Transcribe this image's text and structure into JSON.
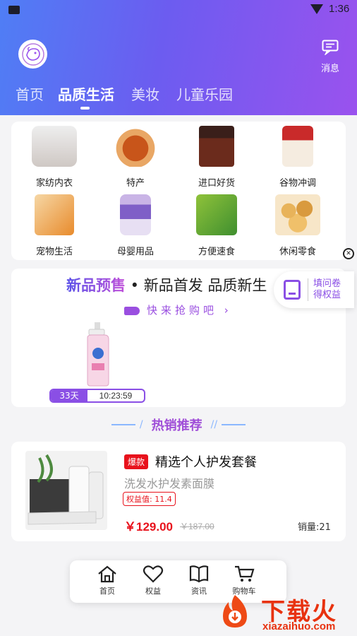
{
  "status_bar": {
    "time": "1:36"
  },
  "header": {
    "message_label": "消息",
    "tabs": [
      {
        "label": "首页",
        "active": false
      },
      {
        "label": "品质生活",
        "active": true
      },
      {
        "label": "美妆",
        "active": false
      },
      {
        "label": "儿童乐园",
        "active": false
      }
    ]
  },
  "categories": [
    {
      "label": "家纺内衣",
      "icon": "bedding-image"
    },
    {
      "label": "特产",
      "icon": "roast-chicken-image"
    },
    {
      "label": "进口好货",
      "icon": "cosmetic-jar-image"
    },
    {
      "label": "谷物冲调",
      "icon": "cereal-bag-image"
    },
    {
      "label": "宠物生活",
      "icon": "pet-treats-image"
    },
    {
      "label": "母婴用品",
      "icon": "milk-formula-image"
    },
    {
      "label": "方便速食",
      "icon": "instant-noodles-image"
    },
    {
      "label": "休闲零食",
      "icon": "popcorn-image"
    }
  ],
  "presale": {
    "title_highlight": "新品预售",
    "title_rest": " • 新品首发 品质新生",
    "subtitle": "快来抢购吧",
    "countdown_days": "33天",
    "countdown_time": "10:23:59"
  },
  "survey": {
    "line1": "填问卷",
    "line2": "得权益"
  },
  "hot_section": {
    "title": "热销推荐"
  },
  "product": {
    "badge": "爆款",
    "name": "精选个人护发套餐",
    "subtitle": "洗发水护发素面膜",
    "tag": "权益值: 11.4",
    "price": "￥129.00",
    "old_price": "￥187.00",
    "sales": "销量:21"
  },
  "bottom_nav": [
    {
      "label": "首页",
      "icon": "home-icon"
    },
    {
      "label": "权益",
      "icon": "heart-icon"
    },
    {
      "label": "资讯",
      "icon": "book-icon"
    },
    {
      "label": "购物车",
      "icon": "cart-icon"
    }
  ],
  "watermark": {
    "text": "下载火",
    "url": "xiazaihuo.com"
  },
  "colors": {
    "accent": "#8a4fe5",
    "price_red": "#e8121c",
    "header_start": "#4f7ef5",
    "header_end": "#9a52ee"
  }
}
